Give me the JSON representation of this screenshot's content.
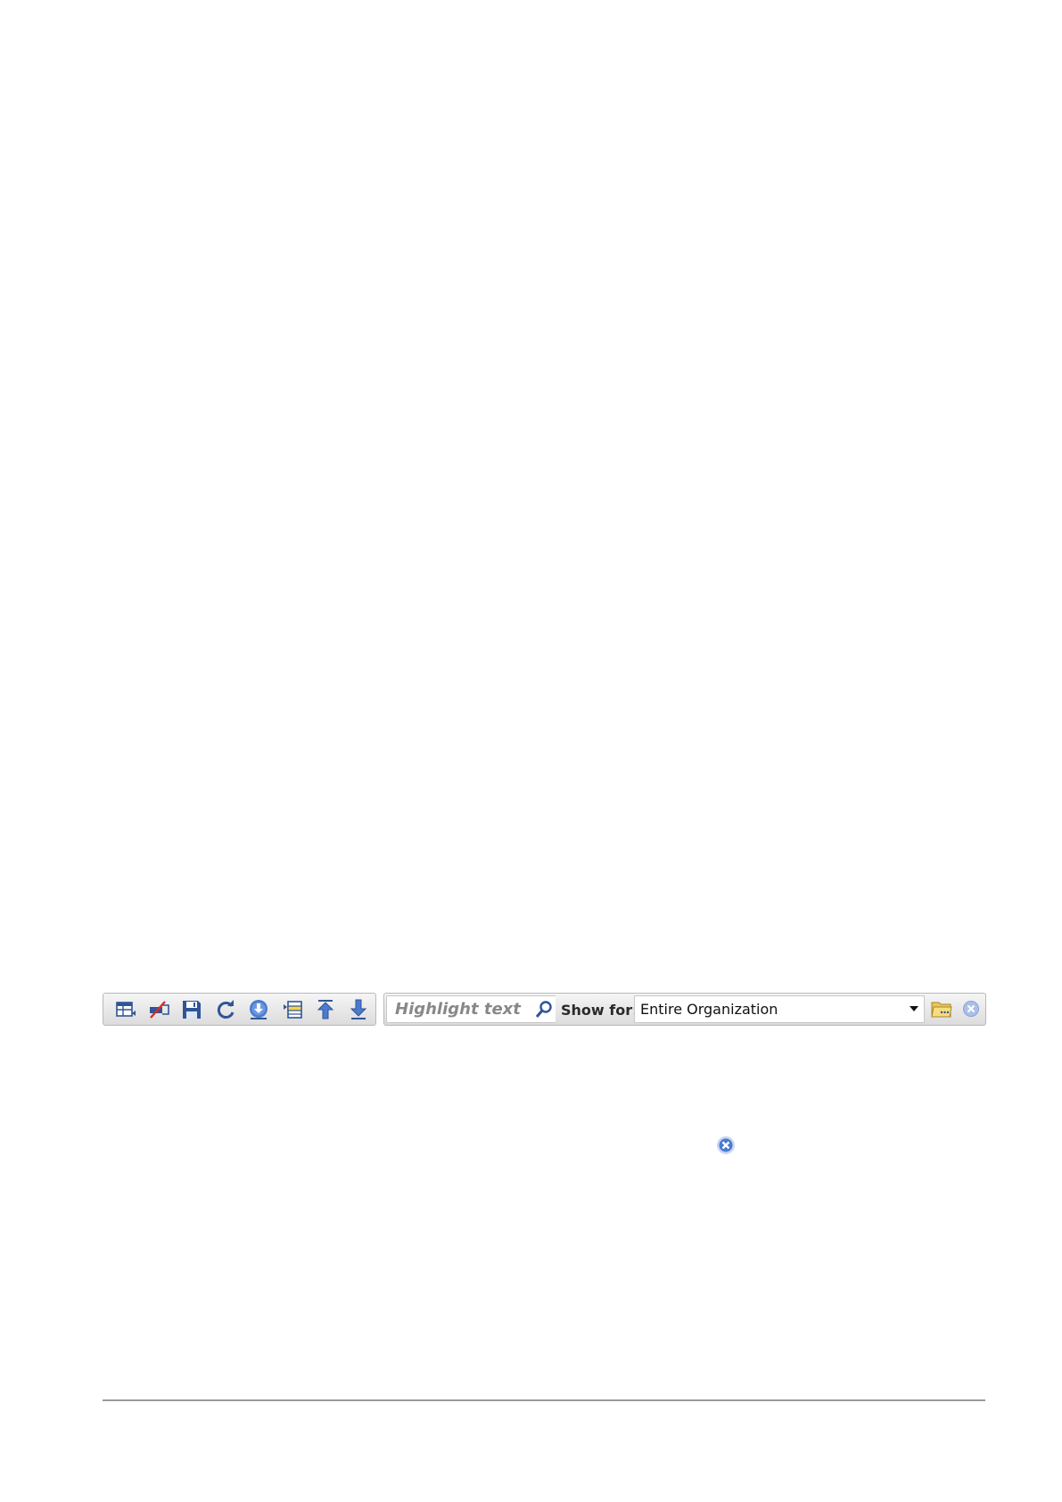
{
  "toolbar": {
    "buttons": [
      {
        "icon": "table-layout-icon"
      },
      {
        "icon": "edit-off-icon"
      },
      {
        "icon": "save-icon"
      },
      {
        "icon": "refresh-icon"
      },
      {
        "icon": "download-icon"
      },
      {
        "icon": "insert-row-icon"
      },
      {
        "icon": "move-to-top-icon"
      },
      {
        "icon": "move-down-icon"
      }
    ],
    "search": {
      "placeholder": "Highlight text",
      "value": ""
    },
    "show_for": {
      "label": "Show for:",
      "selected": "Entire Organization"
    }
  },
  "colors": {
    "icon_blue": "#2f5597",
    "icon_light_blue": "#4a7bd0",
    "clear_blue": "#5b85d6",
    "folder_yellow": "#e8c75a"
  }
}
